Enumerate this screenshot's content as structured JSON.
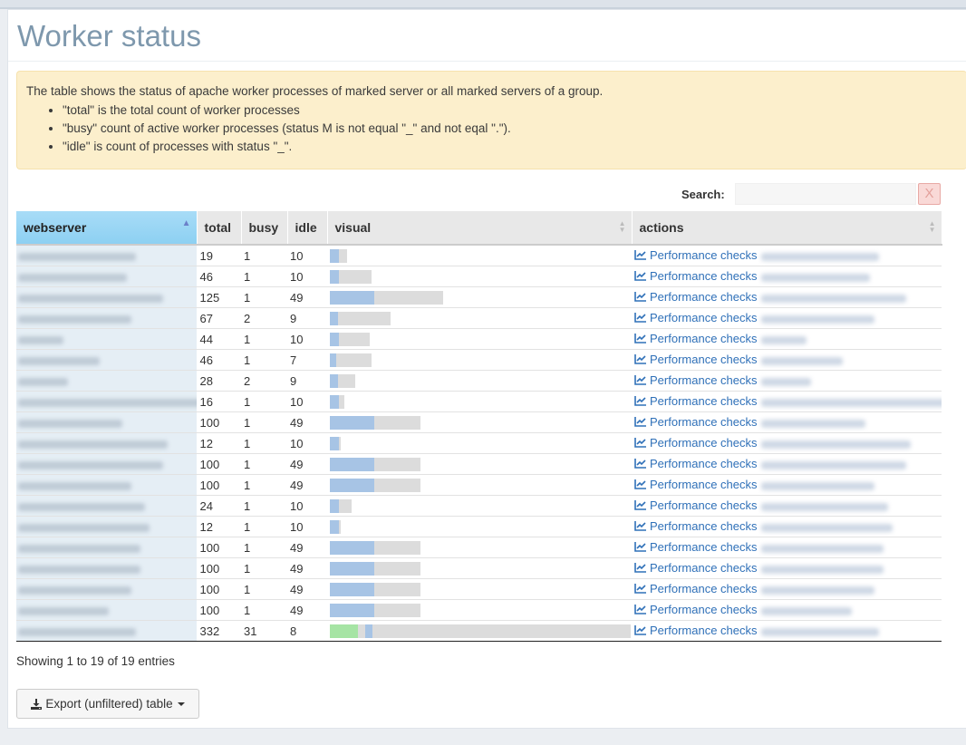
{
  "page": {
    "title": "Worker status"
  },
  "info": {
    "intro": "The table shows the status of apache worker processes of marked server or all marked servers of a group.",
    "bullets": [
      "\"total\" is the total count of worker processes",
      "\"busy\" count of active worker processes (status M is not equal \"_\" and not eqal \".\").",
      "\"idle\" is count of processes with status \"_\"."
    ]
  },
  "search": {
    "label": "Search:",
    "value": "",
    "clear_label": "X"
  },
  "table": {
    "columns": [
      "webserver",
      "total",
      "busy",
      "idle",
      "visual",
      "actions"
    ],
    "action_label": "Performance checks",
    "rows": [
      {
        "total": 19,
        "busy": 1,
        "idle": 10
      },
      {
        "total": 46,
        "busy": 1,
        "idle": 10
      },
      {
        "total": 125,
        "busy": 1,
        "idle": 49
      },
      {
        "total": 67,
        "busy": 2,
        "idle": 9
      },
      {
        "total": 44,
        "busy": 1,
        "idle": 10
      },
      {
        "total": 46,
        "busy": 1,
        "idle": 7
      },
      {
        "total": 28,
        "busy": 2,
        "idle": 9
      },
      {
        "total": 16,
        "busy": 1,
        "idle": 10
      },
      {
        "total": 100,
        "busy": 1,
        "idle": 49
      },
      {
        "total": 12,
        "busy": 1,
        "idle": 10
      },
      {
        "total": 100,
        "busy": 1,
        "idle": 49
      },
      {
        "total": 100,
        "busy": 1,
        "idle": 49
      },
      {
        "total": 24,
        "busy": 1,
        "idle": 10
      },
      {
        "total": 12,
        "busy": 1,
        "idle": 10
      },
      {
        "total": 100,
        "busy": 1,
        "idle": 49
      },
      {
        "total": 100,
        "busy": 1,
        "idle": 49
      },
      {
        "total": 100,
        "busy": 1,
        "idle": 49
      },
      {
        "total": 100,
        "busy": 1,
        "idle": 49
      },
      {
        "total": 332,
        "busy": 31,
        "idle": 8
      }
    ]
  },
  "footer": {
    "showing": "Showing 1 to 19 of 19 entries",
    "export_label": "Export (unfiltered) table"
  },
  "icons": {
    "sort": "sort-asc-icon",
    "action": "line-chart-icon",
    "export": "download-icon",
    "clear": "close-icon"
  },
  "colors": {
    "idle": "#a7c4e5",
    "busy": "#a6e4a4",
    "total": "#dcdcdc",
    "link": "#2f70b8",
    "title": "#7e98ad"
  }
}
